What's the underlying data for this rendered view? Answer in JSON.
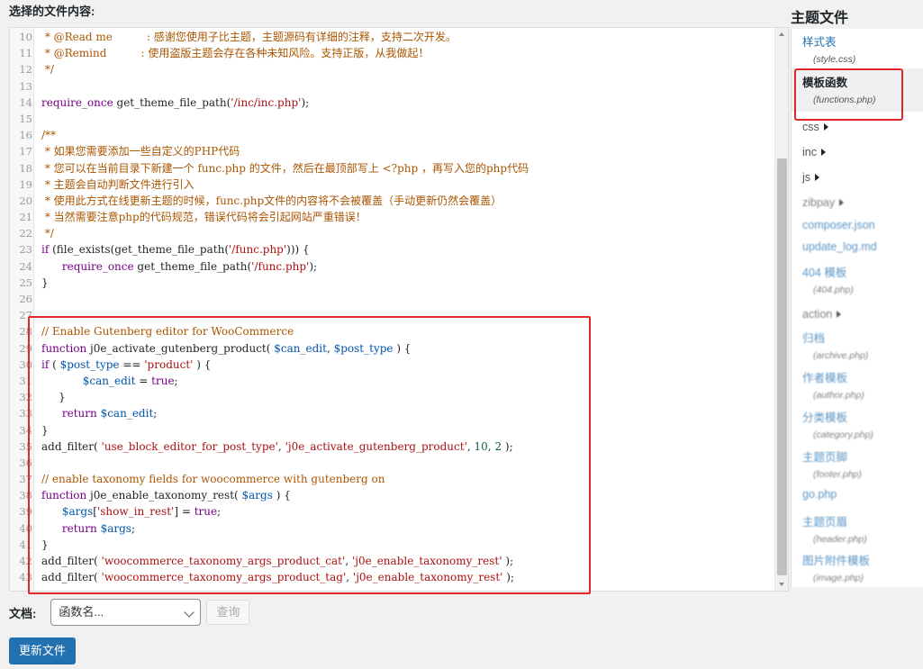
{
  "header": {
    "label": "选择的文件内容:"
  },
  "code_lines": [
    {
      "ln": "10",
      "tokens": [
        {
          "t": " * @Read me          : 感谢您使用子比主题，主题源码有详细的注释，支持二次开发。",
          "c": "comment"
        }
      ]
    },
    {
      "ln": "11",
      "tokens": [
        {
          "t": " * @Remind          : 使用盗版主题会存在各种未知风险。支持正版，从我做起！",
          "c": "comment"
        }
      ]
    },
    {
      "ln": "12",
      "tokens": [
        {
          "t": " */",
          "c": "comment"
        }
      ]
    },
    {
      "ln": "13",
      "tokens": []
    },
    {
      "ln": "14",
      "tokens": [
        {
          "t": "require_once",
          "c": "kw"
        },
        {
          "t": " get_theme_file_path(",
          "c": "fn"
        },
        {
          "t": "'/inc/inc.php'",
          "c": "str"
        },
        {
          "t": ");",
          "c": "fn"
        }
      ]
    },
    {
      "ln": "15",
      "tokens": []
    },
    {
      "ln": "16",
      "tokens": [
        {
          "t": "/**",
          "c": "comment"
        }
      ]
    },
    {
      "ln": "17",
      "tokens": [
        {
          "t": " * 如果您需要添加一些自定义的PHP代码",
          "c": "comment"
        }
      ]
    },
    {
      "ln": "18",
      "tokens": [
        {
          "t": " * 您可以在当前目录下新建一个 func.php 的文件，然后在最顶部写上 <?php ，再写入您的php代码",
          "c": "comment"
        }
      ]
    },
    {
      "ln": "19",
      "tokens": [
        {
          "t": " * 主题会自动判断文件进行引入",
          "c": "comment"
        }
      ]
    },
    {
      "ln": "20",
      "tokens": [
        {
          "t": " * 使用此方式在线更新主题的时候，func.php文件的内容将不会被覆盖（手动更新仍然会覆盖）",
          "c": "comment"
        }
      ]
    },
    {
      "ln": "21",
      "tokens": [
        {
          "t": " * 当然需要注意php的代码规范，错误代码将会引起网站严重错误！",
          "c": "comment"
        }
      ]
    },
    {
      "ln": "22",
      "tokens": [
        {
          "t": " */",
          "c": "comment"
        }
      ]
    },
    {
      "ln": "23",
      "tokens": [
        {
          "t": "if",
          "c": "kw"
        },
        {
          "t": " (file_exists(get_theme_file_path(",
          "c": "fn"
        },
        {
          "t": "'/func.php'",
          "c": "str"
        },
        {
          "t": "))) {",
          "c": "fn"
        }
      ]
    },
    {
      "ln": "24",
      "tokens": [
        {
          "t": "      ",
          "c": "fn"
        },
        {
          "t": "require_once",
          "c": "kw"
        },
        {
          "t": " get_theme_file_path(",
          "c": "fn"
        },
        {
          "t": "'/func.php'",
          "c": "str"
        },
        {
          "t": ");",
          "c": "fn"
        }
      ]
    },
    {
      "ln": "25",
      "tokens": [
        {
          "t": "}",
          "c": "fn"
        }
      ]
    },
    {
      "ln": "26",
      "tokens": []
    },
    {
      "ln": "27",
      "tokens": []
    },
    {
      "ln": "28",
      "tokens": [
        {
          "t": "// Enable Gutenberg editor for WooCommerce",
          "c": "comment"
        }
      ]
    },
    {
      "ln": "29",
      "tokens": [
        {
          "t": "function",
          "c": "kw"
        },
        {
          "t": " j0e_activate_gutenberg_product( ",
          "c": "fn"
        },
        {
          "t": "$can_edit",
          "c": "var"
        },
        {
          "t": ", ",
          "c": "fn"
        },
        {
          "t": "$post_type",
          "c": "var"
        },
        {
          "t": " ) {",
          "c": "fn"
        }
      ]
    },
    {
      "ln": "30",
      "tokens": [
        {
          "t": "if",
          "c": "kw"
        },
        {
          "t": " ( ",
          "c": "fn"
        },
        {
          "t": "$post_type",
          "c": "var"
        },
        {
          "t": " == ",
          "c": "fn"
        },
        {
          "t": "'product'",
          "c": "str"
        },
        {
          "t": " ) {",
          "c": "fn"
        }
      ]
    },
    {
      "ln": "31",
      "tokens": [
        {
          "t": "            ",
          "c": "fn"
        },
        {
          "t": "$can_edit",
          "c": "var"
        },
        {
          "t": " = ",
          "c": "fn"
        },
        {
          "t": "true",
          "c": "kw"
        },
        {
          "t": ";",
          "c": "fn"
        }
      ]
    },
    {
      "ln": "32",
      "tokens": [
        {
          "t": "     }",
          "c": "fn"
        }
      ]
    },
    {
      "ln": "33",
      "tokens": [
        {
          "t": "      ",
          "c": "fn"
        },
        {
          "t": "return",
          "c": "kw"
        },
        {
          "t": " ",
          "c": "fn"
        },
        {
          "t": "$can_edit",
          "c": "var"
        },
        {
          "t": ";",
          "c": "fn"
        }
      ]
    },
    {
      "ln": "34",
      "tokens": [
        {
          "t": "}",
          "c": "fn"
        }
      ]
    },
    {
      "ln": "35",
      "tokens": [
        {
          "t": "add_filter( ",
          "c": "fn"
        },
        {
          "t": "'use_block_editor_for_post_type'",
          "c": "str"
        },
        {
          "t": ", ",
          "c": "fn"
        },
        {
          "t": "'j0e_activate_gutenberg_product'",
          "c": "str"
        },
        {
          "t": ", ",
          "c": "fn"
        },
        {
          "t": "10",
          "c": "num"
        },
        {
          "t": ", ",
          "c": "fn"
        },
        {
          "t": "2",
          "c": "num"
        },
        {
          "t": " );",
          "c": "fn"
        }
      ]
    },
    {
      "ln": "36",
      "tokens": []
    },
    {
      "ln": "37",
      "tokens": [
        {
          "t": "// enable taxonomy fields for woocommerce with gutenberg on",
          "c": "comment"
        }
      ]
    },
    {
      "ln": "38",
      "tokens": [
        {
          "t": "function",
          "c": "kw"
        },
        {
          "t": " j0e_enable_taxonomy_rest( ",
          "c": "fn"
        },
        {
          "t": "$args",
          "c": "var"
        },
        {
          "t": " ) {",
          "c": "fn"
        }
      ]
    },
    {
      "ln": "39",
      "tokens": [
        {
          "t": "      ",
          "c": "fn"
        },
        {
          "t": "$args",
          "c": "var"
        },
        {
          "t": "[",
          "c": "fn"
        },
        {
          "t": "'show_in_rest'",
          "c": "str"
        },
        {
          "t": "] = ",
          "c": "fn"
        },
        {
          "t": "true",
          "c": "kw"
        },
        {
          "t": ";",
          "c": "fn"
        }
      ]
    },
    {
      "ln": "40",
      "tokens": [
        {
          "t": "      ",
          "c": "fn"
        },
        {
          "t": "return",
          "c": "kw"
        },
        {
          "t": " ",
          "c": "fn"
        },
        {
          "t": "$args",
          "c": "var"
        },
        {
          "t": ";",
          "c": "fn"
        }
      ]
    },
    {
      "ln": "41",
      "tokens": [
        {
          "t": "}",
          "c": "fn"
        }
      ]
    },
    {
      "ln": "42",
      "tokens": [
        {
          "t": "add_filter( ",
          "c": "fn"
        },
        {
          "t": "'woocommerce_taxonomy_args_product_cat'",
          "c": "str"
        },
        {
          "t": ", ",
          "c": "fn"
        },
        {
          "t": "'j0e_enable_taxonomy_rest'",
          "c": "str"
        },
        {
          "t": " );",
          "c": "fn"
        }
      ]
    },
    {
      "ln": "43",
      "tokens": [
        {
          "t": "add_filter( ",
          "c": "fn"
        },
        {
          "t": "'woocommerce_taxonomy_args_product_tag'",
          "c": "str"
        },
        {
          "t": ", ",
          "c": "fn"
        },
        {
          "t": "'j0e_enable_taxonomy_rest'",
          "c": "str"
        },
        {
          "t": " );",
          "c": "fn"
        }
      ]
    }
  ],
  "doc_row": {
    "label": "文档:",
    "select_value": "函数名...",
    "query_label": "查询"
  },
  "update_button": "更新文件",
  "sidebar": {
    "title": "主题文件",
    "items": [
      {
        "name": "样式表",
        "sub": "(style.css)",
        "type": "file",
        "active": false,
        "blur": false
      },
      {
        "name": "模板函数",
        "sub": "(functions.php)",
        "type": "file",
        "active": true,
        "blur": false
      },
      {
        "name": "css",
        "sub": "",
        "type": "folder",
        "active": false,
        "blur": false
      },
      {
        "name": "inc",
        "sub": "",
        "type": "folder",
        "active": false,
        "blur": false
      },
      {
        "name": "js",
        "sub": "",
        "type": "folder",
        "active": false,
        "blur": false
      },
      {
        "name": "zibpay",
        "sub": "",
        "type": "folder",
        "active": false,
        "blur": true
      },
      {
        "name": "composer.json",
        "sub": "",
        "type": "file",
        "active": false,
        "blur": true
      },
      {
        "name": "update_log.md",
        "sub": "",
        "type": "file",
        "active": false,
        "blur": true
      },
      {
        "name": "404 模板",
        "sub": "(404.php)",
        "type": "file",
        "active": false,
        "blur": true
      },
      {
        "name": "action",
        "sub": "",
        "type": "folder",
        "active": false,
        "blur": true
      },
      {
        "name": "归档",
        "sub": "(archive.php)",
        "type": "file",
        "active": false,
        "blur": true
      },
      {
        "name": "作者模板",
        "sub": "(author.php)",
        "type": "file",
        "active": false,
        "blur": true
      },
      {
        "name": "分类模板",
        "sub": "(category.php)",
        "type": "file",
        "active": false,
        "blur": true
      },
      {
        "name": "主题页脚",
        "sub": "(footer.php)",
        "type": "file",
        "active": false,
        "blur": true
      },
      {
        "name": "go.php",
        "sub": "",
        "type": "file",
        "active": false,
        "blur": true
      },
      {
        "name": "主题页眉",
        "sub": "(header.php)",
        "type": "file",
        "active": false,
        "blur": true
      },
      {
        "name": "图片附件模板",
        "sub": "(image.php)",
        "type": "file",
        "active": false,
        "blur": true
      }
    ]
  },
  "colors": {
    "accent": "#2271b1",
    "highlight_border": "#e0262a",
    "comment": "#aa5500",
    "keyword": "#770088",
    "string": "#aa1111",
    "variable": "#0055aa"
  }
}
